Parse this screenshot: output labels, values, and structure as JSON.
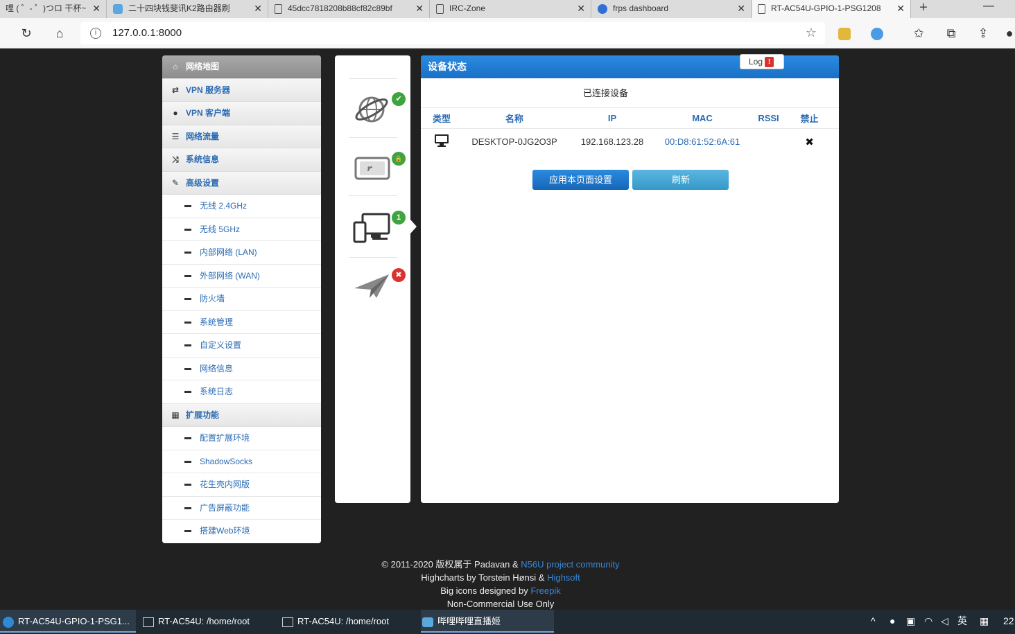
{
  "browser": {
    "tabs": [
      {
        "title": "哩 ( ゜- ゜)つロ 干杯~"
      },
      {
        "title": "二十四块钱斐讯K2路由器刷"
      },
      {
        "title": "45dcc7818208b88cf82c89bf"
      },
      {
        "title": "IRC-Zone"
      },
      {
        "title": "frps dashboard"
      },
      {
        "title": "RT-AC54U-GPIO-1-PSG1208"
      }
    ],
    "url": "127.0.0.1:8000"
  },
  "sidebar": {
    "top": [
      {
        "label": "网络地图"
      },
      {
        "label": "VPN 服务器"
      },
      {
        "label": "VPN 客户端"
      },
      {
        "label": "网络流量"
      },
      {
        "label": "系统信息"
      },
      {
        "label": "高级设置"
      }
    ],
    "advanced": [
      {
        "label": "无线 2.4GHz"
      },
      {
        "label": "无线 5GHz"
      },
      {
        "label": "内部网络 (LAN)"
      },
      {
        "label": "外部网络 (WAN)"
      },
      {
        "label": "防火墙"
      },
      {
        "label": "系统管理"
      },
      {
        "label": "自定义设置"
      },
      {
        "label": "网络信息"
      },
      {
        "label": "系统日志"
      }
    ],
    "ext_header": "扩展功能",
    "extensions": [
      {
        "label": "配置扩展环境"
      },
      {
        "label": "ShadowSocks"
      },
      {
        "label": "花生壳内网版"
      },
      {
        "label": "广告屏蔽功能"
      },
      {
        "label": "搭建Web环境"
      }
    ]
  },
  "status_icons": {
    "internet_badge": "✔",
    "wireless_badge": "🔒",
    "clients_badge": "1",
    "usb_badge": "✖"
  },
  "panel": {
    "title": "设备状态",
    "log_label": "Log",
    "log_badge": "!",
    "subtitle": "已连接设备",
    "columns": [
      "类型",
      "名称",
      "IP",
      "MAC",
      "RSSI",
      "禁止"
    ],
    "rows": [
      {
        "name": "DESKTOP-0JG2O3P",
        "ip": "192.168.123.28",
        "mac": "00:D8:61:52:6A:61",
        "rssi": "",
        "block": "✖"
      }
    ],
    "apply_label": "应用本页面设置",
    "refresh_label": "刷新"
  },
  "footer": {
    "line1_prefix": "© 2011-2020 版权属于 Padavan & ",
    "line1_link": "N56U project community",
    "line2_prefix": "Highcharts by Torstein Hønsi & ",
    "line2_link": "Highsoft",
    "line3_prefix": "Big icons designed by ",
    "line3_link": "Freepik",
    "line4": "Non-Commercial Use Only"
  },
  "taskbar": {
    "tasks": [
      {
        "label": "RT-AC54U-GPIO-1-PSG1..."
      },
      {
        "label": "RT-AC54U: /home/root"
      },
      {
        "label": "RT-AC54U: /home/root"
      },
      {
        "label": "哔哩哔哩直播姬"
      }
    ],
    "ime": "英",
    "clock": "22"
  },
  "colors": {
    "accent": "#1a6fc7",
    "link": "#2a6bb3",
    "success": "#3fa43f",
    "danger": "#d9322f"
  }
}
